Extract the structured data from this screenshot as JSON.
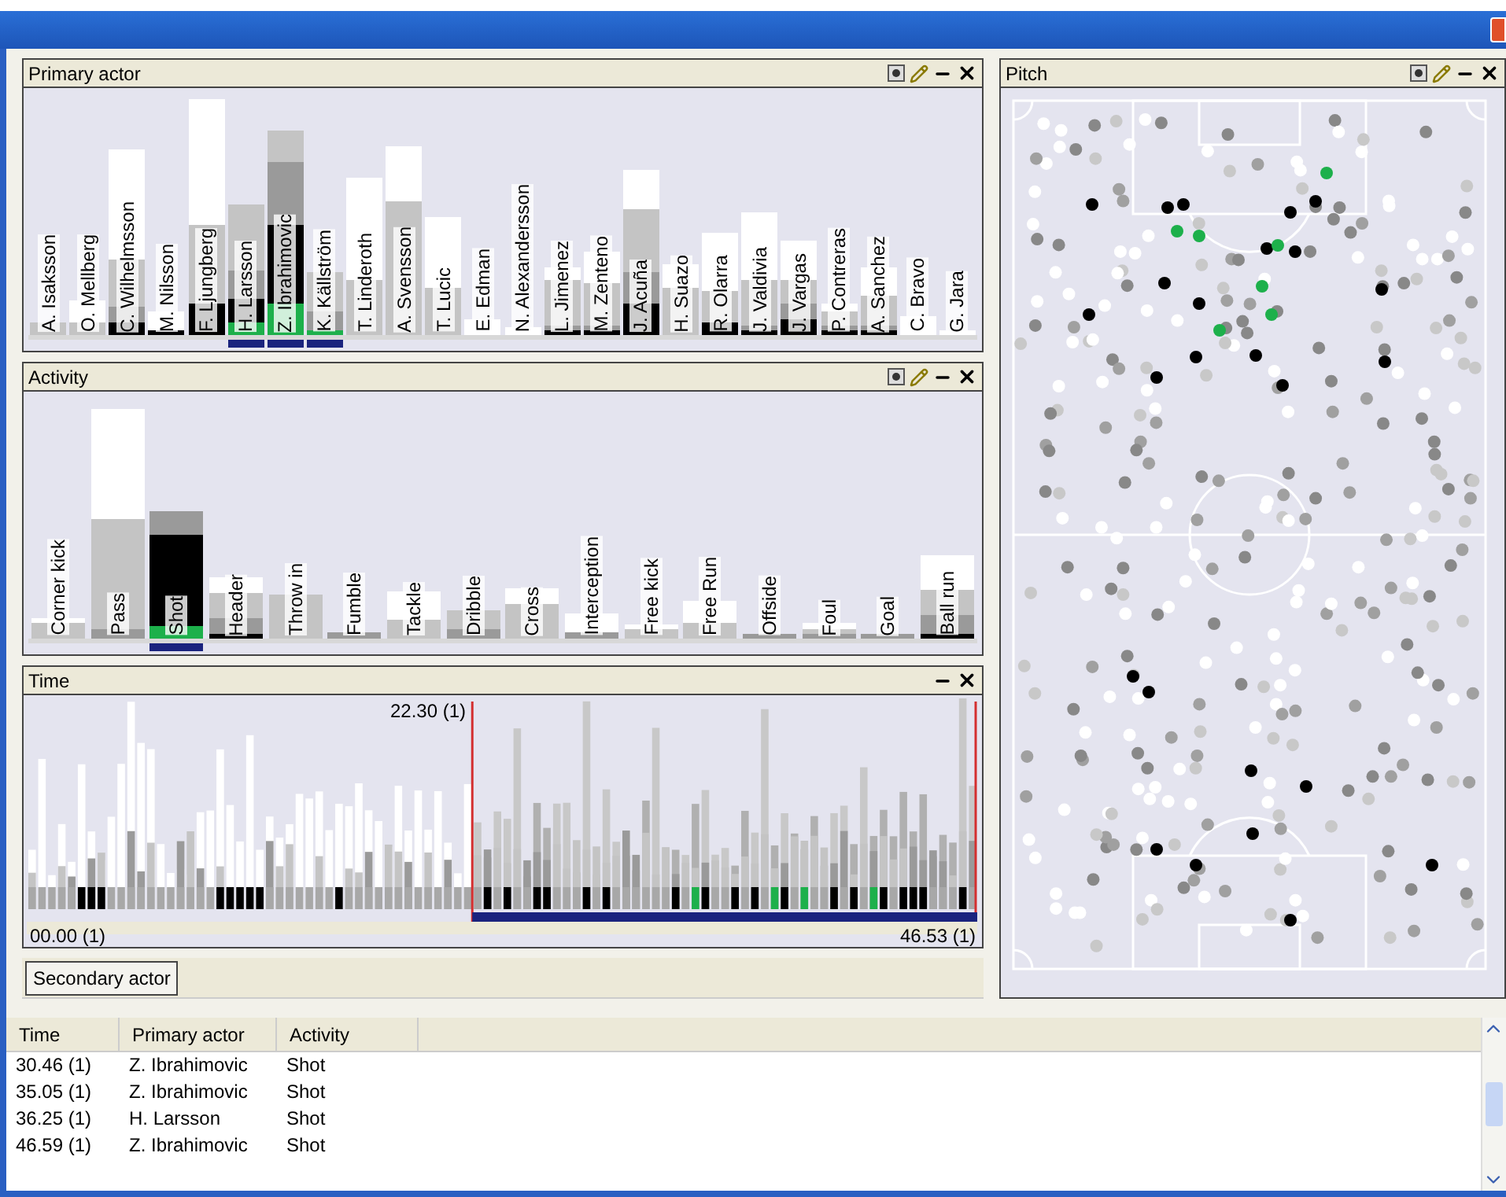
{
  "panels": {
    "primary_actor": {
      "title": "Primary actor",
      "actors": [
        {
          "name": "A. Isaksson",
          "selected": false
        },
        {
          "name": "O. Mellberg",
          "selected": false
        },
        {
          "name": "C. Wilhelmsson",
          "selected": false
        },
        {
          "name": "M. Nilsson",
          "selected": false
        },
        {
          "name": "F. Ljungberg",
          "selected": false
        },
        {
          "name": "H. Larsson",
          "selected": true
        },
        {
          "name": "Z. Ibrahimovic",
          "selected": true
        },
        {
          "name": "K. Källström",
          "selected": true
        },
        {
          "name": "T. Linderoth",
          "selected": false
        },
        {
          "name": "A. Svensson",
          "selected": false
        },
        {
          "name": "T. Lucic",
          "selected": false
        },
        {
          "name": "E. Edman",
          "selected": false
        },
        {
          "name": "N. Alexandersson",
          "selected": false
        },
        {
          "name": "L. Jimenez",
          "selected": false
        },
        {
          "name": "M. Zenteno",
          "selected": false
        },
        {
          "name": "J. Acuña",
          "selected": false
        },
        {
          "name": "H. Suazo",
          "selected": false
        },
        {
          "name": "R. Olarra",
          "selected": false
        },
        {
          "name": "J. Valdivia",
          "selected": false
        },
        {
          "name": "J. Vargas",
          "selected": false
        },
        {
          "name": "P. Contreras",
          "selected": false
        },
        {
          "name": "A. Sanchez",
          "selected": false
        },
        {
          "name": "C. Bravo",
          "selected": false
        },
        {
          "name": "G. Jara",
          "selected": false
        }
      ]
    },
    "activity": {
      "title": "Activity",
      "activities": [
        {
          "name": "Corner kick",
          "selected": false
        },
        {
          "name": "Pass",
          "selected": false
        },
        {
          "name": "Shot",
          "selected": true
        },
        {
          "name": "Header",
          "selected": false
        },
        {
          "name": "Throw in",
          "selected": false
        },
        {
          "name": "Fumble",
          "selected": false
        },
        {
          "name": "Tackle",
          "selected": false
        },
        {
          "name": "Dribble",
          "selected": false
        },
        {
          "name": "Cross",
          "selected": false
        },
        {
          "name": "Interception",
          "selected": false
        },
        {
          "name": "Free kick",
          "selected": false
        },
        {
          "name": "Free Run",
          "selected": false
        },
        {
          "name": "Offside",
          "selected": false
        },
        {
          "name": "Foul",
          "selected": false
        },
        {
          "name": "Goal",
          "selected": false
        },
        {
          "name": "Ball run",
          "selected": false
        }
      ]
    },
    "time": {
      "title": "Time",
      "marker_label": "22.30 (1)",
      "start_label": "00.00 (1)",
      "end_label": "46.53 (1)"
    },
    "pitch": {
      "title": "Pitch"
    }
  },
  "tabs": [
    {
      "label": "Secondary actor",
      "selected": true
    }
  ],
  "table": {
    "columns": [
      "Time",
      "Primary actor",
      "Activity"
    ],
    "rows": [
      [
        "30.46 (1)",
        "Z. Ibrahimovic",
        "Shot"
      ],
      [
        "35.05 (1)",
        "Z. Ibrahimovic",
        "Shot"
      ],
      [
        "36.25 (1)",
        "H. Larsson",
        "Shot"
      ],
      [
        "46.59 (1)",
        "Z. Ibrahimovic",
        "Shot"
      ]
    ]
  }
}
